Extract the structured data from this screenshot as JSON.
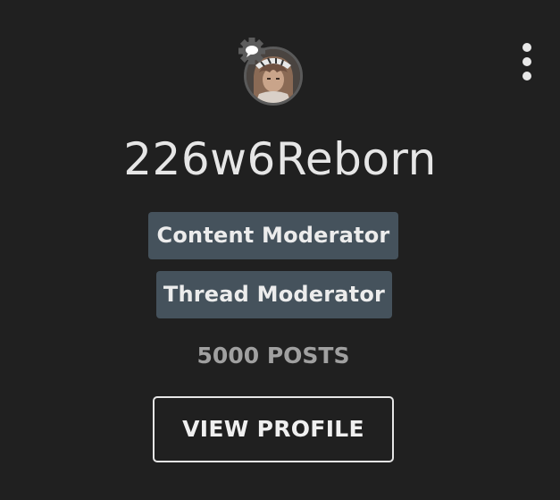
{
  "profile": {
    "username": "226w6Reborn",
    "avatar_alt": "user-avatar",
    "roles": [
      {
        "label": "Content Moderator"
      },
      {
        "label": "Thread Moderator"
      }
    ],
    "posts_label": "5000 POSTS",
    "view_profile_label": "VIEW PROFILE"
  },
  "icons": {
    "menu": "more-vertical-icon",
    "chat_badge": "chat-bubble-icon"
  },
  "colors": {
    "background": "#202020",
    "role_badge_bg": "#45525c",
    "text_primary": "#e6e6e6",
    "text_muted": "#a0a0a0"
  }
}
